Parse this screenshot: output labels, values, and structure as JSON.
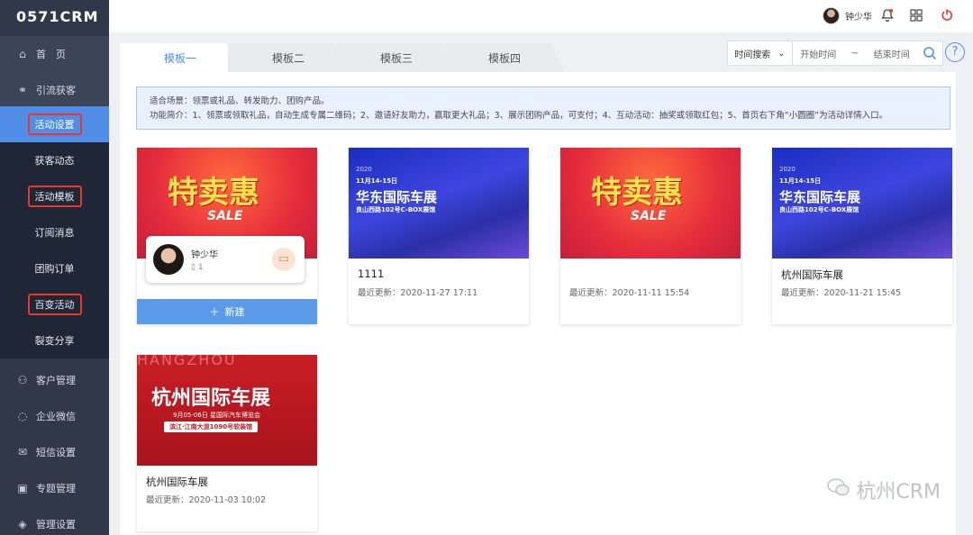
{
  "app": {
    "logo": "0571CRM"
  },
  "sidebar": {
    "items": [
      {
        "label": "首　页",
        "icon": "home-icon",
        "glyph": "⌂"
      },
      {
        "label": "引流获客",
        "icon": "share-icon",
        "glyph": "⚭"
      },
      {
        "label": "客户管理",
        "icon": "user-icon",
        "glyph": "⚇"
      },
      {
        "label": "企业微信",
        "icon": "wechat-icon",
        "glyph": "◌"
      },
      {
        "label": "短信设置",
        "icon": "mail-icon",
        "glyph": "✉"
      },
      {
        "label": "专题管理",
        "icon": "topic-icon",
        "glyph": "▣"
      },
      {
        "label": "管理设置",
        "icon": "settings-icon",
        "glyph": "◈"
      }
    ],
    "subitems": [
      "活动设置",
      "获客动态",
      "活动模板",
      "订阅消息",
      "团购订单",
      "百变活动",
      "裂变分享"
    ]
  },
  "header": {
    "username": "钟少华"
  },
  "tabs": [
    "模板一",
    "模板二",
    "模板三",
    "模板四"
  ],
  "search": {
    "type": "时间搜索",
    "start": "开始时间",
    "sep": "~",
    "end": "结束时间"
  },
  "help": "?",
  "notice": {
    "line1": "适合场景：领票或礼品、转发助力、团购产品。",
    "line2": "功能简介：1、领票或领取礼品，自动生成专属二维码；2、邀请好友助力，赢取更大礼品；3、展示团购产品，可支付；4、互动活动：抽奖或领取红包；5、首页右下角“小圆圈”为活动详情入口。"
  },
  "new_card": {
    "button": "新建",
    "profile_name": "钟少华",
    "profile_phone": "1"
  },
  "cards": [
    {
      "title": "1111",
      "time": "最近更新：2020-11-27 17:11",
      "theme": "blue"
    },
    {
      "title": "",
      "time": "最近更新：2020-11-11 15:54",
      "theme": "red"
    },
    {
      "title": "杭州国际车展",
      "time": "最近更新：2020-11-21 15:45",
      "theme": "blue"
    },
    {
      "title": "杭州国际车展",
      "time": "最近更新：2020-11-03 10:02",
      "theme": "dred"
    }
  ],
  "posters": {
    "sale": {
      "big": "特卖惠",
      "en": "SALE"
    },
    "expo": {
      "date": "11月14-15日",
      "title": "华东国际车展",
      "addr": "良山西路102号C-BOX展馆",
      "year": "2020"
    },
    "hz": {
      "title": "杭州国际车展",
      "en": "HANGZHOU",
      "sub": "9月05-06日 星国际汽车博览会",
      "addr": "滨江·江南大道1090号软装馆"
    }
  },
  "watermark": "杭州CRM",
  "colors": {
    "accent": "#4f8de6",
    "sidebar": "#30384a",
    "highlight": "#e8362d"
  }
}
